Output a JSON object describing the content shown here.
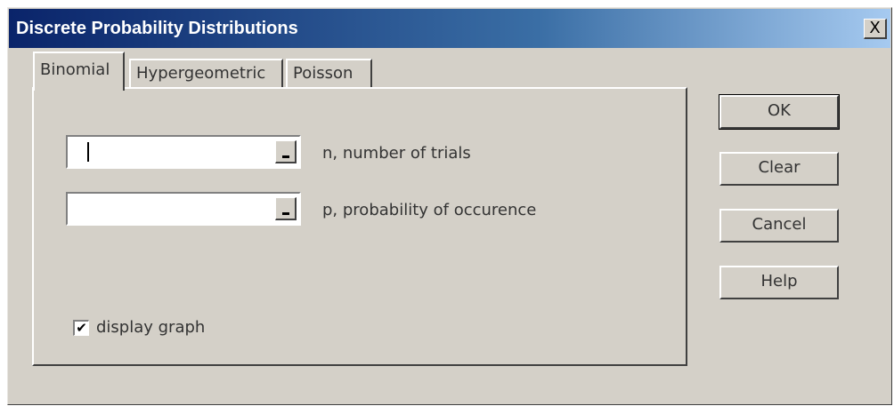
{
  "window": {
    "title": "Discrete Probability Distributions",
    "close_symbol": "X"
  },
  "tabs": [
    {
      "label": "Binomial",
      "active": true
    },
    {
      "label": "Hypergeometric",
      "active": false
    },
    {
      "label": "Poisson",
      "active": false
    }
  ],
  "fields": {
    "n": {
      "value": "",
      "label": "n, number of trials"
    },
    "p": {
      "value": "",
      "label": "p, probability of occurence"
    }
  },
  "checkbox": {
    "label": "display graph",
    "checked": true,
    "mark": "✔"
  },
  "buttons": {
    "ok": "OK",
    "clear": "Clear",
    "cancel": "Cancel",
    "help": "Help"
  },
  "colors": {
    "dialog_bg": "#d4d0c8",
    "title_gradient_start": "#0a246a",
    "title_gradient_end": "#a6caf0"
  },
  "icons": {
    "close": "close-icon",
    "collapse": "collapse-dialog-icon",
    "check": "checkmark-icon"
  }
}
